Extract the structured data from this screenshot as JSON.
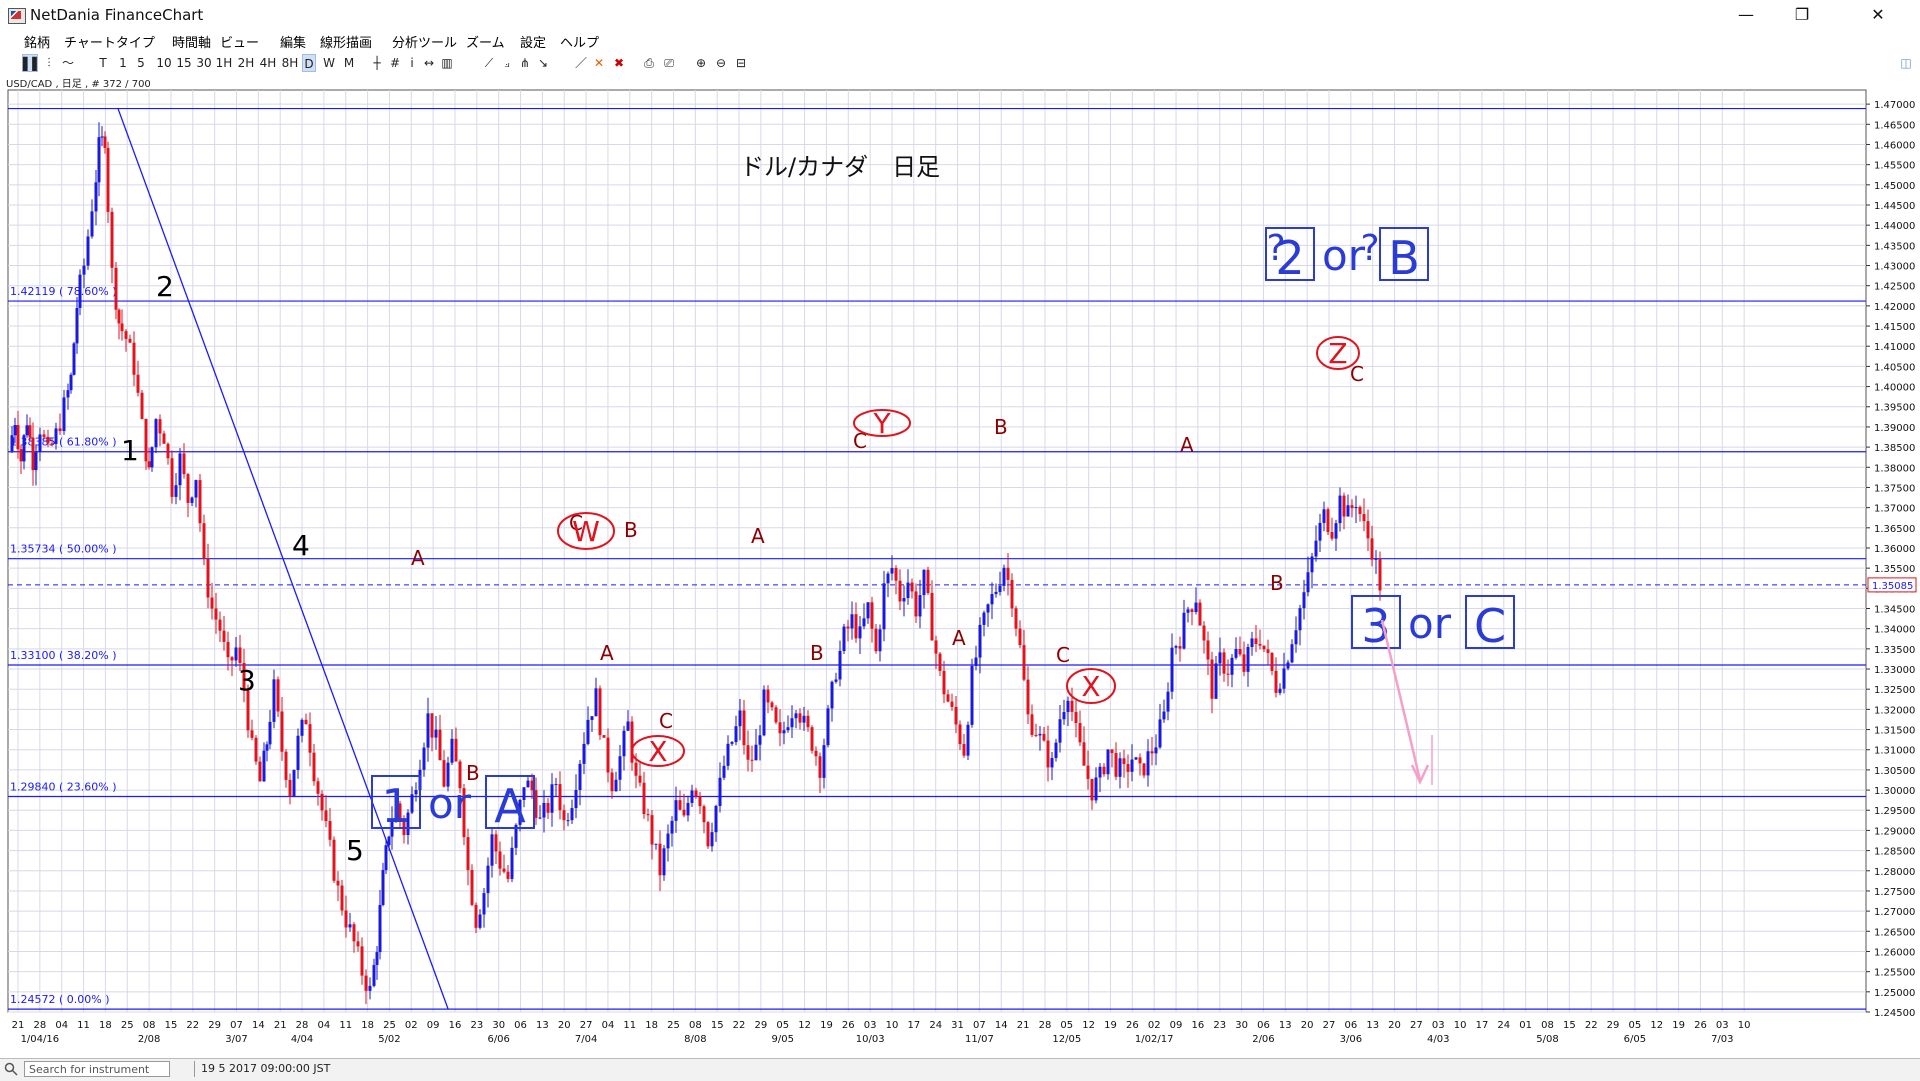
{
  "window": {
    "title": "NetDania FinanceChart",
    "controls": [
      "—",
      "❐",
      "✕"
    ]
  },
  "menu": [
    "銘柄",
    "チャートタイプ",
    "時間軸",
    "ビュー",
    "編集",
    "線形描画",
    "分析ツール",
    "ズーム",
    "設定",
    "ヘルプ"
  ],
  "toolbar": {
    "periods": [
      "T",
      "1",
      "5",
      "10",
      "15",
      "30",
      "1H",
      "2H",
      "4H",
      "8H",
      "D",
      "W",
      "M"
    ],
    "active_period": "D"
  },
  "symbol_info": "USD/CAD , 日足 , # 372 / 700",
  "chart_data": {
    "type": "candlestick",
    "title": "ドル/カナダ　日足",
    "y_range": [
      1.245,
      1.4735
    ],
    "y_ticks": [
      "1.47000",
      "1.46500",
      "1.46000",
      "1.45500",
      "1.45000",
      "1.44500",
      "1.44000",
      "1.43500",
      "1.43000",
      "1.42500",
      "1.42000",
      "1.41500",
      "1.41000",
      "1.40500",
      "1.40000",
      "1.39500",
      "1.39000",
      "1.38500",
      "1.38000",
      "1.37500",
      "1.37000",
      "1.36500",
      "1.36000",
      "1.35500",
      "1.35000",
      "1.34500",
      "1.34000",
      "1.33500",
      "1.33000",
      "1.32500",
      "1.32000",
      "1.31500",
      "1.31000",
      "1.30500",
      "1.30000",
      "1.29500",
      "1.29000",
      "1.28500",
      "1.28000",
      "1.27500",
      "1.27000",
      "1.26500",
      "1.26000",
      "1.25500",
      "1.25000",
      "1.24500"
    ],
    "current_price": "1.35085",
    "fib_levels": [
      {
        "value": 1.4689,
        "label": ""
      },
      {
        "value": 1.42119,
        "label": "1.42119 ( 78.60% )"
      },
      {
        "value": 1.38385,
        "label": "1.38385 ( 61.80% )"
      },
      {
        "value": 1.35734,
        "label": "1.35734 ( 50.00% )"
      },
      {
        "value": 1.331,
        "label": "1.33100 ( 38.20% )"
      },
      {
        "value": 1.2984,
        "label": "1.29840 ( 23.60% )"
      },
      {
        "value": 1.24572,
        "label": "1.24572 ( 0.00% )"
      }
    ],
    "x_tick_days": [
      "21",
      "28",
      "04",
      "11",
      "18",
      "25",
      "08",
      "15",
      "22",
      "29",
      "07",
      "14",
      "21",
      "28",
      "04",
      "11",
      "18",
      "25",
      "02",
      "09",
      "16",
      "23",
      "30",
      "06",
      "13",
      "20",
      "27",
      "04",
      "11",
      "18",
      "25",
      "08",
      "15",
      "22",
      "29",
      "05",
      "12",
      "19",
      "26",
      "03",
      "10",
      "17",
      "24",
      "31",
      "07",
      "14",
      "21",
      "28",
      "05",
      "12",
      "19",
      "26",
      "02",
      "09",
      "16",
      "23",
      "30",
      "06",
      "13",
      "20",
      "27",
      "06",
      "13",
      "20",
      "27",
      "03",
      "10",
      "17",
      "24",
      "01",
      "08",
      "15",
      "22",
      "29",
      "05",
      "12",
      "19",
      "26",
      "03",
      "10"
    ],
    "x_month_labels": [
      "1/04/16",
      "2/08",
      "3/07",
      "4/04",
      "5/02",
      "6/06",
      "7/04",
      "8/08",
      "9/05",
      "10/03",
      "11/07",
      "12/05",
      "1/02/17",
      "2/06",
      "3/06",
      "4/03",
      "5/08",
      "6/05",
      "7/03"
    ],
    "ohlc_path": [
      [
        0,
        1.384
      ],
      [
        6,
        1.392
      ],
      [
        12,
        1.382
      ],
      [
        18,
        1.392
      ],
      [
        24,
        1.382
      ],
      [
        32,
        1.39
      ],
      [
        40,
        1.383
      ],
      [
        48,
        1.388
      ],
      [
        56,
        1.395
      ],
      [
        62,
        1.402
      ],
      [
        68,
        1.42
      ],
      [
        76,
        1.43
      ],
      [
        84,
        1.445
      ],
      [
        90,
        1.459
      ],
      [
        96,
        1.462
      ],
      [
        104,
        1.428
      ],
      [
        110,
        1.416
      ],
      [
        118,
        1.412
      ],
      [
        126,
        1.405
      ],
      [
        134,
        1.39
      ],
      [
        140,
        1.378
      ],
      [
        148,
        1.392
      ],
      [
        156,
        1.388
      ],
      [
        164,
        1.375
      ],
      [
        172,
        1.382
      ],
      [
        180,
        1.372
      ],
      [
        188,
        1.378
      ],
      [
        196,
        1.355
      ],
      [
        204,
        1.345
      ],
      [
        212,
        1.34
      ],
      [
        220,
        1.33
      ],
      [
        228,
        1.335
      ],
      [
        236,
        1.325
      ],
      [
        244,
        1.31
      ],
      [
        252,
        1.302
      ],
      [
        258,
        1.312
      ],
      [
        266,
        1.325
      ],
      [
        274,
        1.31
      ],
      [
        282,
        1.3
      ],
      [
        290,
        1.312
      ],
      [
        298,
        1.318
      ],
      [
        306,
        1.305
      ],
      [
        314,
        1.295
      ],
      [
        322,
        1.285
      ],
      [
        330,
        1.275
      ],
      [
        338,
        1.268
      ],
      [
        346,
        1.262
      ],
      [
        354,
        1.255
      ],
      [
        362,
        1.25
      ],
      [
        368,
        1.262
      ],
      [
        374,
        1.278
      ],
      [
        380,
        1.29
      ],
      [
        388,
        1.296
      ],
      [
        396,
        1.29
      ],
      [
        404,
        1.298
      ],
      [
        412,
        1.308
      ],
      [
        420,
        1.318
      ],
      [
        428,
        1.312
      ],
      [
        436,
        1.302
      ],
      [
        444,
        1.31
      ],
      [
        452,
        1.302
      ],
      [
        460,
        1.28
      ],
      [
        468,
        1.268
      ],
      [
        476,
        1.275
      ],
      [
        484,
        1.288
      ],
      [
        492,
        1.282
      ],
      [
        500,
        1.278
      ],
      [
        508,
        1.29
      ],
      [
        516,
        1.302
      ],
      [
        524,
        1.3
      ],
      [
        532,
        1.292
      ],
      [
        540,
        1.296
      ],
      [
        548,
        1.302
      ],
      [
        556,
        1.292
      ],
      [
        564,
        1.298
      ],
      [
        572,
        1.308
      ],
      [
        580,
        1.318
      ],
      [
        588,
        1.323
      ],
      [
        596,
        1.31
      ],
      [
        604,
        1.302
      ],
      [
        612,
        1.308
      ],
      [
        620,
        1.316
      ],
      [
        628,
        1.302
      ],
      [
        636,
        1.296
      ],
      [
        644,
        1.288
      ],
      [
        652,
        1.28
      ],
      [
        660,
        1.288
      ],
      [
        668,
        1.296
      ],
      [
        676,
        1.292
      ],
      [
        684,
        1.302
      ],
      [
        692,
        1.298
      ],
      [
        700,
        1.288
      ],
      [
        708,
        1.296
      ],
      [
        716,
        1.306
      ],
      [
        724,
        1.312
      ],
      [
        732,
        1.318
      ],
      [
        740,
        1.306
      ],
      [
        748,
        1.31
      ],
      [
        756,
        1.322
      ],
      [
        764,
        1.318
      ],
      [
        772,
        1.312
      ],
      [
        780,
        1.318
      ],
      [
        788,
        1.322
      ],
      [
        796,
        1.316
      ],
      [
        804,
        1.312
      ],
      [
        812,
        1.306
      ],
      [
        820,
        1.318
      ],
      [
        828,
        1.33
      ],
      [
        836,
        1.338
      ],
      [
        844,
        1.342
      ],
      [
        852,
        1.338
      ],
      [
        860,
        1.345
      ],
      [
        868,
        1.334
      ],
      [
        876,
        1.35
      ],
      [
        884,
        1.355
      ],
      [
        892,
        1.348
      ],
      [
        900,
        1.352
      ],
      [
        908,
        1.345
      ],
      [
        916,
        1.352
      ],
      [
        924,
        1.34
      ],
      [
        932,
        1.328
      ],
      [
        940,
        1.322
      ],
      [
        948,
        1.316
      ],
      [
        956,
        1.31
      ],
      [
        964,
        1.328
      ],
      [
        972,
        1.338
      ],
      [
        980,
        1.345
      ],
      [
        988,
        1.35
      ],
      [
        996,
        1.356
      ],
      [
        1004,
        1.348
      ],
      [
        1012,
        1.335
      ],
      [
        1020,
        1.318
      ],
      [
        1028,
        1.315
      ],
      [
        1036,
        1.31
      ],
      [
        1044,
        1.306
      ],
      [
        1052,
        1.318
      ],
      [
        1060,
        1.325
      ],
      [
        1068,
        1.314
      ],
      [
        1076,
        1.306
      ],
      [
        1084,
        1.3
      ],
      [
        1092,
        1.303
      ],
      [
        1100,
        1.31
      ],
      [
        1108,
        1.306
      ],
      [
        1116,
        1.304
      ],
      [
        1124,
        1.308
      ],
      [
        1132,
        1.304
      ],
      [
        1140,
        1.308
      ],
      [
        1148,
        1.312
      ],
      [
        1156,
        1.318
      ],
      [
        1164,
        1.335
      ],
      [
        1172,
        1.338
      ],
      [
        1180,
        1.345
      ],
      [
        1188,
        1.348
      ],
      [
        1196,
        1.336
      ],
      [
        1204,
        1.325
      ],
      [
        1212,
        1.332
      ],
      [
        1220,
        1.33
      ],
      [
        1228,
        1.334
      ],
      [
        1236,
        1.33
      ],
      [
        1244,
        1.336
      ],
      [
        1252,
        1.338
      ],
      [
        1260,
        1.332
      ],
      [
        1268,
        1.326
      ],
      [
        1276,
        1.33
      ],
      [
        1284,
        1.338
      ],
      [
        1292,
        1.345
      ],
      [
        1300,
        1.352
      ],
      [
        1308,
        1.362
      ],
      [
        1316,
        1.368
      ],
      [
        1324,
        1.365
      ],
      [
        1332,
        1.372
      ],
      [
        1340,
        1.368
      ],
      [
        1348,
        1.372
      ],
      [
        1356,
        1.365
      ],
      [
        1364,
        1.36
      ],
      [
        1372,
        1.351
      ]
    ],
    "wave_labels": [
      {
        "text": "1",
        "x": 121,
        "y": 460,
        "color": "#000",
        "size": 28
      },
      {
        "text": "2",
        "x": 156,
        "y": 296,
        "color": "#000",
        "size": 28
      },
      {
        "text": "3",
        "x": 238,
        "y": 690,
        "color": "#000",
        "size": 28
      },
      {
        "text": "4",
        "x": 292,
        "y": 555,
        "color": "#000",
        "size": 28
      },
      {
        "text": "5",
        "x": 346,
        "y": 860,
        "color": "#000",
        "size": 28
      },
      {
        "text": "A",
        "x": 411,
        "y": 565,
        "color": "#8b0000",
        "size": 20
      },
      {
        "text": "B",
        "x": 466,
        "y": 780,
        "color": "#8b0000",
        "size": 20
      },
      {
        "text": "C",
        "x": 569,
        "y": 530,
        "color": "#8b0000",
        "size": 20
      },
      {
        "text": "B",
        "x": 624,
        "y": 537,
        "color": "#8b0000",
        "size": 20
      },
      {
        "text": "A",
        "x": 600,
        "y": 660,
        "color": "#8b0000",
        "size": 20
      },
      {
        "text": "C",
        "x": 659,
        "y": 728,
        "color": "#8b0000",
        "size": 20
      },
      {
        "text": "A",
        "x": 751,
        "y": 543,
        "color": "#8b0000",
        "size": 20
      },
      {
        "text": "B",
        "x": 810,
        "y": 660,
        "color": "#8b0000",
        "size": 20
      },
      {
        "text": "C",
        "x": 853,
        "y": 448,
        "color": "#8b0000",
        "size": 20
      },
      {
        "text": "B",
        "x": 994,
        "y": 434,
        "color": "#8b0000",
        "size": 20
      },
      {
        "text": "A",
        "x": 952,
        "y": 645,
        "color": "#8b0000",
        "size": 20
      },
      {
        "text": "C",
        "x": 1056,
        "y": 662,
        "color": "#8b0000",
        "size": 20
      },
      {
        "text": "A",
        "x": 1180,
        "y": 452,
        "color": "#8b0000",
        "size": 20
      },
      {
        "text": "B",
        "x": 1270,
        "y": 590,
        "color": "#8b0000",
        "size": 20
      },
      {
        "text": "C",
        "x": 1350,
        "y": 381,
        "color": "#8b0000",
        "size": 20
      }
    ],
    "circled_labels": [
      {
        "text": "W",
        "cx": 586,
        "cy": 531,
        "rx": 28,
        "ry": 18
      },
      {
        "text": "X",
        "cx": 658,
        "cy": 751,
        "rx": 26,
        "ry": 15
      },
      {
        "text": "Y",
        "cx": 882,
        "cy": 423,
        "rx": 28,
        "ry": 13
      },
      {
        "text": "X",
        "cx": 1091,
        "cy": 686,
        "rx": 24,
        "ry": 17
      },
      {
        "text": "Z",
        "cx": 1338,
        "cy": 353,
        "rx": 21,
        "ry": 16
      }
    ],
    "boxed_labels": [
      {
        "parts": [
          {
            "t": "1",
            "box": true
          },
          {
            "t": "or",
            "box": false
          },
          {
            "t": "A",
            "box": true
          }
        ],
        "x": 372,
        "y": 822
      },
      {
        "parts": [
          {
            "t": "2",
            "box": true
          },
          {
            "t": "or",
            "box": false
          },
          {
            "t": "B",
            "box": true
          }
        ],
        "x": 1266,
        "y": 274
      },
      {
        "parts": [
          {
            "t": "3",
            "box": true
          },
          {
            "t": "or",
            "box": false
          },
          {
            "t": "C",
            "box": true
          }
        ],
        "x": 1352,
        "y": 642
      }
    ],
    "question_marks": [
      {
        "x": 1276,
        "y": 260
      },
      {
        "x": 1370,
        "y": 260
      }
    ],
    "question_symbol": "?"
  },
  "status": {
    "search_placeholder": "Search for instrument",
    "datetime": "19 5 2017 09:00:00 JST"
  },
  "colors": {
    "fib_line": "#1a1aff",
    "bull": "#1a1adb",
    "bear": "#e0141e",
    "grid": "#d8d8e8",
    "annotation_red": "#e0141e",
    "annotation_blue": "#2a3bd6",
    "projection": "#f5a0c8"
  }
}
